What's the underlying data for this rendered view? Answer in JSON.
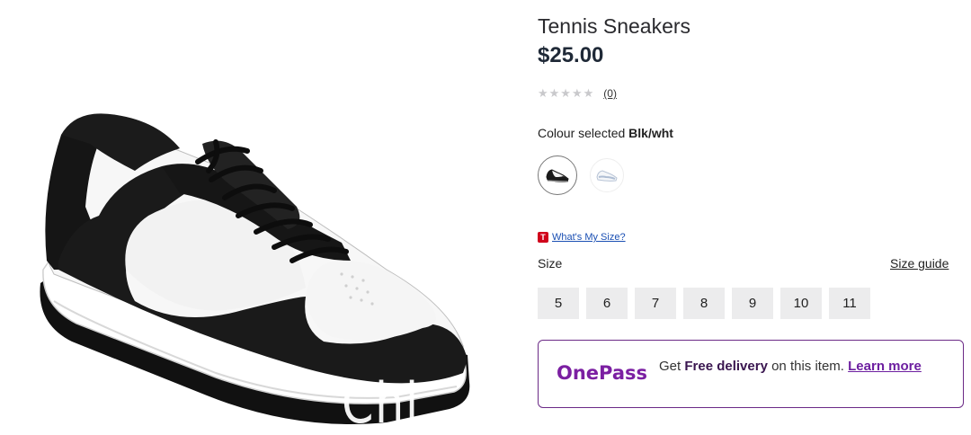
{
  "product": {
    "title": "Tennis Sneakers",
    "price": "$25.00",
    "rating_stars": "★★★★★",
    "review_count": "(0)",
    "colour_prefix": "Colour selected",
    "colour_value": "Blk/wht"
  },
  "size_section": {
    "whats_my_size_badge": "T",
    "whats_my_size": "What's My Size?",
    "label": "Size",
    "guide": "Size guide",
    "options": [
      "5",
      "6",
      "7",
      "8",
      "9",
      "10",
      "11"
    ]
  },
  "onepass": {
    "logo": "OnePass",
    "text_prefix": "Get",
    "text_bold": "Free delivery",
    "text_suffix": "on this item.",
    "learn_more": "Learn more",
    "accent_color": "#7b1fa2"
  },
  "watermark": "Chi"
}
